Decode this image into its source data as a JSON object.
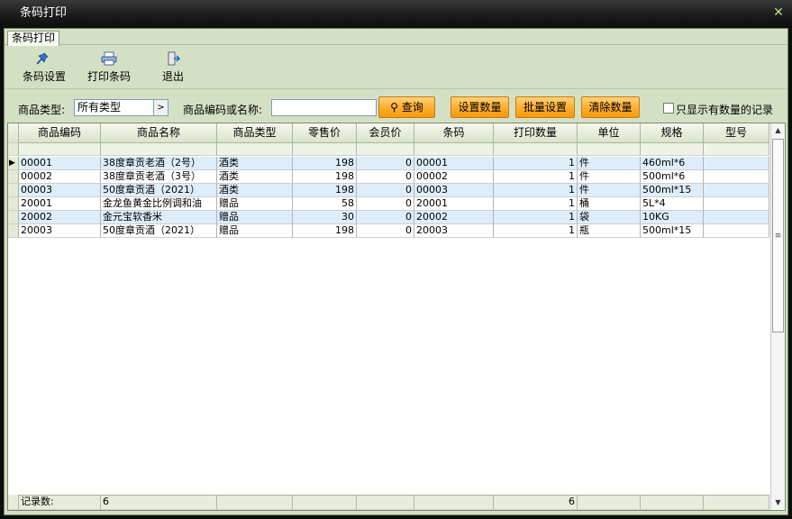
{
  "window": {
    "title": "条码打印"
  },
  "tab": {
    "label": "条码打印"
  },
  "toolbar": {
    "barcode_settings": "条码设置",
    "print_barcode": "打印条码",
    "exit": "退出"
  },
  "filter": {
    "type_label": "商品类型:",
    "type_value": "所有类型",
    "code_name_label": "商品编码或名称:",
    "search_value": "",
    "query_button": "查询",
    "set_qty_button": "设置数量",
    "batch_set_button": "批量设置",
    "clear_qty_button": "清除数量",
    "only_with_qty_label": "只显示有数量的记录"
  },
  "grid": {
    "columns": [
      "商品编码",
      "商品名称",
      "商品类型",
      "零售价",
      "会员价",
      "条码",
      "打印数量",
      "单位",
      "规格",
      "型号"
    ],
    "rows": [
      [
        "00001",
        "38度章贡老酒（2号）",
        "酒类",
        "198",
        "0",
        "00001",
        "1",
        "件",
        "460ml*6",
        ""
      ],
      [
        "00002",
        "38度章贡老酒（3号）",
        "酒类",
        "198",
        "0",
        "00002",
        "1",
        "件",
        "500ml*6",
        ""
      ],
      [
        "00003",
        "50度章贡酒（2021）",
        "酒类",
        "198",
        "0",
        "00003",
        "1",
        "件",
        "500ml*15",
        ""
      ],
      [
        "20001",
        "金龙鱼黄金比例调和油",
        "赠品",
        "58",
        "0",
        "20001",
        "1",
        "桶",
        "5L*4",
        ""
      ],
      [
        "20002",
        "金元宝软香米",
        "赠品",
        "30",
        "0",
        "20002",
        "1",
        "袋",
        "10KG",
        ""
      ],
      [
        "20003",
        "50度章贡酒（2021）",
        "赠品",
        "198",
        "0",
        "20003",
        "1",
        "瓶",
        "500ml*15",
        ""
      ]
    ],
    "footer_label": "记录数:",
    "record_count": "6",
    "print_qty_total": "6"
  },
  "colors": {
    "accent_orange": "#ffac2a",
    "panel_green": "#d4e0c3",
    "row_alt": "#ddeefa"
  }
}
